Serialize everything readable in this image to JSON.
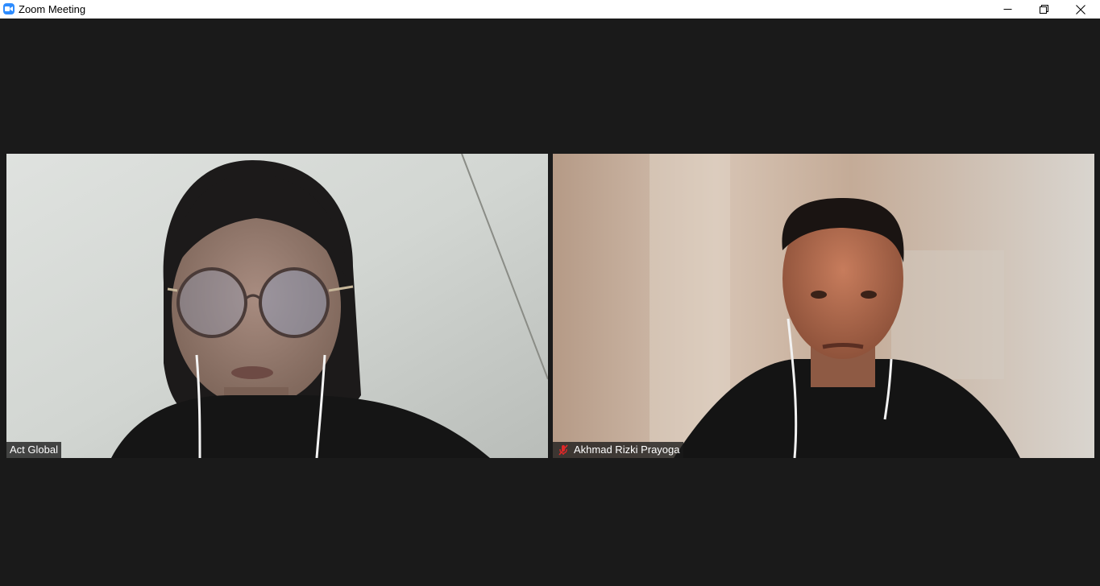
{
  "window": {
    "title": "Zoom Meeting",
    "controls": {
      "minimize_icon": "minimize-icon",
      "restore_icon": "restore-icon",
      "close_icon": "close-icon"
    }
  },
  "participants": [
    {
      "name": "Act Global",
      "muted": false
    },
    {
      "name": "Akhmad Rizki Prayoga",
      "muted": true,
      "mute_icon": "muted-microphone-icon"
    }
  ],
  "colors": {
    "background": "#1a1a1a",
    "titlebar": "#ffffff",
    "zoom_blue": "#2d8cff",
    "mute_red": "#e02828"
  }
}
